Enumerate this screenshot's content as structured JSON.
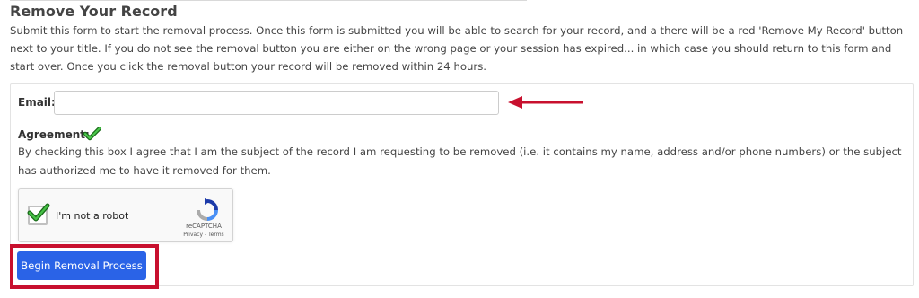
{
  "form": {
    "title": "Remove Your Record",
    "intro": "Submit this form to start the removal process. Once this form is submitted you will be able to search for your record, and a there will be a red 'Remove My Record' button next to your title. If you do not see the removal button you are either on the wrong page or your session has expired... in which case you should return to this form and start over. Once you click the removal button your record will be removed within 24 hours.",
    "email_label": "Email:",
    "email_value": "",
    "agreement_label": "Agreement:",
    "agreement_text": "By checking this box I agree that I am the subject of the record I am requesting to be removed (i.e. it contains my name, address and/or phone numbers) or the subject has authorized me to have it removed for them.",
    "submit_label": "Begin Removal Process"
  },
  "captcha": {
    "label": "I'm not a robot",
    "brand": "reCAPTCHA",
    "privacy": "Privacy",
    "separator": " - ",
    "terms": "Terms",
    "checked": true
  },
  "annotations": {
    "arrow_color": "#c8102e",
    "highlight_color": "#c8102e"
  },
  "colors": {
    "button": "#2a63e7",
    "check": "#2e9e2e"
  }
}
